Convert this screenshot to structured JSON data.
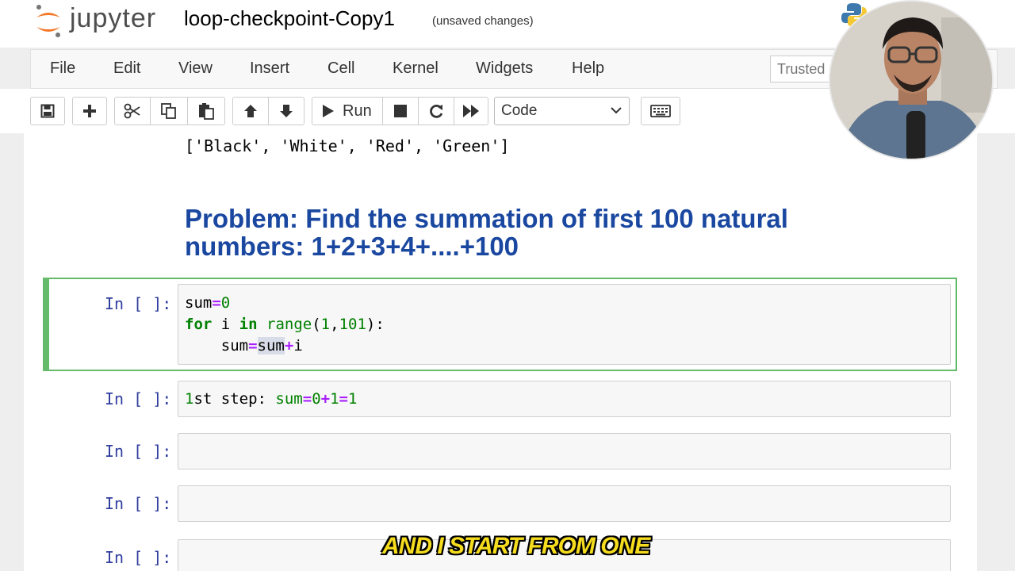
{
  "header": {
    "logo_text": "jupyter",
    "notebook_title": "loop-checkpoint-Copy1",
    "save_status": "(unsaved changes)"
  },
  "menubar": {
    "items": [
      "File",
      "Edit",
      "View",
      "Insert",
      "Cell",
      "Kernel",
      "Widgets",
      "Help"
    ],
    "trusted_label": "Trusted"
  },
  "toolbar": {
    "buttons": [
      "save-icon",
      "plus-icon",
      "scissors-icon",
      "copy-icon",
      "paste-icon",
      "arrow-up-icon",
      "arrow-down-icon",
      "play-icon",
      "stop-icon",
      "restart-icon",
      "fast-forward-icon",
      "keyboard-icon"
    ],
    "run_label": "Run",
    "cell_type": "Code"
  },
  "notebook": {
    "output_text": "['Black', 'White', 'Red', 'Green']",
    "markdown_heading": "Problem: Find the summation of first 100 natural numbers: 1+2+3+4+....+100",
    "cells": [
      {
        "prompt": "In [ ]:",
        "lines": [
          "sum=0",
          "for i in range(1,101):",
          "    sum=sum+i"
        ],
        "selected": true
      },
      {
        "prompt": "In [ ]:",
        "lines": [
          "1st step: sum=0+1=1"
        ],
        "selected": false
      },
      {
        "prompt": "In [ ]:",
        "lines": [],
        "selected": false
      },
      {
        "prompt": "In [ ]:",
        "lines": [],
        "selected": false
      },
      {
        "prompt": "In [ ]:",
        "lines": [],
        "selected": false
      }
    ]
  },
  "caption": "AND I START FROM ONE",
  "colors": {
    "heading_blue": "#1a47a0",
    "selected_cell_green": "#66bb6a",
    "prompt_blue": "#303f9f",
    "keyword_green": "#008000",
    "operator_purple": "#aa22ff",
    "caption_yellow": "#f5dc1e"
  }
}
